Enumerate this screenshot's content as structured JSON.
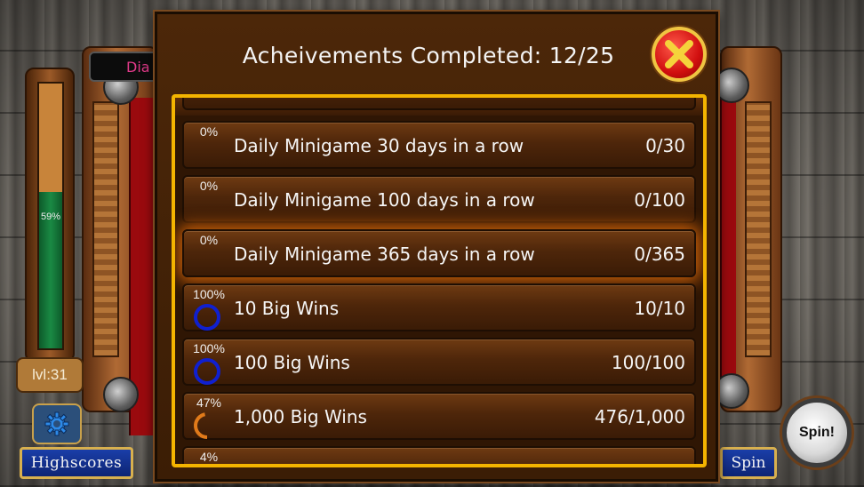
{
  "side_tab_label": "Dia",
  "level": {
    "percent_label": "59%",
    "fill_fraction": 0.59,
    "label": "lvl:31"
  },
  "buttons": {
    "highscores_label": "Highscores",
    "spin_small_label": "Spin",
    "spin_round_label": "Spin!"
  },
  "dialog": {
    "title": "Acheivements Completed: 12/25",
    "achievements": [
      {
        "percent": "0%",
        "name": "Daily Minigame 30 days in a row",
        "progress": "0/30",
        "fraction": 0
      },
      {
        "percent": "0%",
        "name": "Daily Minigame 100 days in a row",
        "progress": "0/100",
        "fraction": 0
      },
      {
        "percent": "0%",
        "name": "Daily Minigame 365 days in a row",
        "progress": "0/365",
        "fraction": 0,
        "highlighted": true
      },
      {
        "percent": "100%",
        "name": "10 Big Wins",
        "progress": "10/10",
        "fraction": 1
      },
      {
        "percent": "100%",
        "name": "100 Big Wins",
        "progress": "100/100",
        "fraction": 1
      },
      {
        "percent": "47%",
        "name": "1,000 Big Wins",
        "progress": "476/1,000",
        "fraction": 0.47
      },
      {
        "percent": "4%"
      }
    ]
  },
  "colors": {
    "ring_complete": "#1020d0",
    "ring_partial": "#e07a1a",
    "list_border": "#f4b400",
    "highlight_glow": "#e86e0a"
  }
}
